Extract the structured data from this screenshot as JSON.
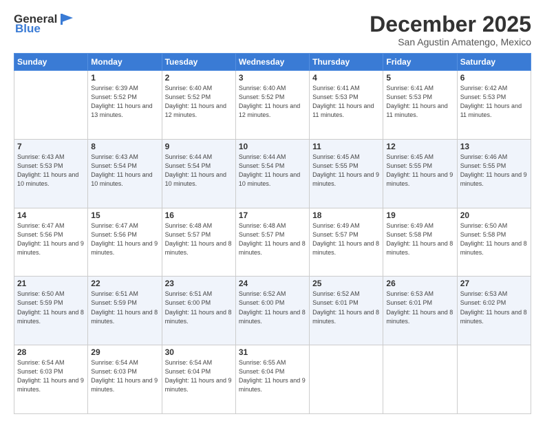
{
  "header": {
    "logo": {
      "general": "General",
      "blue": "Blue"
    },
    "title": "December 2025",
    "location": "San Agustin Amatengo, Mexico"
  },
  "calendar": {
    "weekdays": [
      "Sunday",
      "Monday",
      "Tuesday",
      "Wednesday",
      "Thursday",
      "Friday",
      "Saturday"
    ],
    "rows": [
      [
        {
          "day": "",
          "sunrise": "",
          "sunset": "",
          "daylight": ""
        },
        {
          "day": "1",
          "sunrise": "Sunrise: 6:39 AM",
          "sunset": "Sunset: 5:52 PM",
          "daylight": "Daylight: 11 hours and 13 minutes."
        },
        {
          "day": "2",
          "sunrise": "Sunrise: 6:40 AM",
          "sunset": "Sunset: 5:52 PM",
          "daylight": "Daylight: 11 hours and 12 minutes."
        },
        {
          "day": "3",
          "sunrise": "Sunrise: 6:40 AM",
          "sunset": "Sunset: 5:52 PM",
          "daylight": "Daylight: 11 hours and 12 minutes."
        },
        {
          "day": "4",
          "sunrise": "Sunrise: 6:41 AM",
          "sunset": "Sunset: 5:53 PM",
          "daylight": "Daylight: 11 hours and 11 minutes."
        },
        {
          "day": "5",
          "sunrise": "Sunrise: 6:41 AM",
          "sunset": "Sunset: 5:53 PM",
          "daylight": "Daylight: 11 hours and 11 minutes."
        },
        {
          "day": "6",
          "sunrise": "Sunrise: 6:42 AM",
          "sunset": "Sunset: 5:53 PM",
          "daylight": "Daylight: 11 hours and 11 minutes."
        }
      ],
      [
        {
          "day": "7",
          "sunrise": "Sunrise: 6:43 AM",
          "sunset": "Sunset: 5:53 PM",
          "daylight": "Daylight: 11 hours and 10 minutes."
        },
        {
          "day": "8",
          "sunrise": "Sunrise: 6:43 AM",
          "sunset": "Sunset: 5:54 PM",
          "daylight": "Daylight: 11 hours and 10 minutes."
        },
        {
          "day": "9",
          "sunrise": "Sunrise: 6:44 AM",
          "sunset": "Sunset: 5:54 PM",
          "daylight": "Daylight: 11 hours and 10 minutes."
        },
        {
          "day": "10",
          "sunrise": "Sunrise: 6:44 AM",
          "sunset": "Sunset: 5:54 PM",
          "daylight": "Daylight: 11 hours and 10 minutes."
        },
        {
          "day": "11",
          "sunrise": "Sunrise: 6:45 AM",
          "sunset": "Sunset: 5:55 PM",
          "daylight": "Daylight: 11 hours and 9 minutes."
        },
        {
          "day": "12",
          "sunrise": "Sunrise: 6:45 AM",
          "sunset": "Sunset: 5:55 PM",
          "daylight": "Daylight: 11 hours and 9 minutes."
        },
        {
          "day": "13",
          "sunrise": "Sunrise: 6:46 AM",
          "sunset": "Sunset: 5:55 PM",
          "daylight": "Daylight: 11 hours and 9 minutes."
        }
      ],
      [
        {
          "day": "14",
          "sunrise": "Sunrise: 6:47 AM",
          "sunset": "Sunset: 5:56 PM",
          "daylight": "Daylight: 11 hours and 9 minutes."
        },
        {
          "day": "15",
          "sunrise": "Sunrise: 6:47 AM",
          "sunset": "Sunset: 5:56 PM",
          "daylight": "Daylight: 11 hours and 9 minutes."
        },
        {
          "day": "16",
          "sunrise": "Sunrise: 6:48 AM",
          "sunset": "Sunset: 5:57 PM",
          "daylight": "Daylight: 11 hours and 8 minutes."
        },
        {
          "day": "17",
          "sunrise": "Sunrise: 6:48 AM",
          "sunset": "Sunset: 5:57 PM",
          "daylight": "Daylight: 11 hours and 8 minutes."
        },
        {
          "day": "18",
          "sunrise": "Sunrise: 6:49 AM",
          "sunset": "Sunset: 5:57 PM",
          "daylight": "Daylight: 11 hours and 8 minutes."
        },
        {
          "day": "19",
          "sunrise": "Sunrise: 6:49 AM",
          "sunset": "Sunset: 5:58 PM",
          "daylight": "Daylight: 11 hours and 8 minutes."
        },
        {
          "day": "20",
          "sunrise": "Sunrise: 6:50 AM",
          "sunset": "Sunset: 5:58 PM",
          "daylight": "Daylight: 11 hours and 8 minutes."
        }
      ],
      [
        {
          "day": "21",
          "sunrise": "Sunrise: 6:50 AM",
          "sunset": "Sunset: 5:59 PM",
          "daylight": "Daylight: 11 hours and 8 minutes."
        },
        {
          "day": "22",
          "sunrise": "Sunrise: 6:51 AM",
          "sunset": "Sunset: 5:59 PM",
          "daylight": "Daylight: 11 hours and 8 minutes."
        },
        {
          "day": "23",
          "sunrise": "Sunrise: 6:51 AM",
          "sunset": "Sunset: 6:00 PM",
          "daylight": "Daylight: 11 hours and 8 minutes."
        },
        {
          "day": "24",
          "sunrise": "Sunrise: 6:52 AM",
          "sunset": "Sunset: 6:00 PM",
          "daylight": "Daylight: 11 hours and 8 minutes."
        },
        {
          "day": "25",
          "sunrise": "Sunrise: 6:52 AM",
          "sunset": "Sunset: 6:01 PM",
          "daylight": "Daylight: 11 hours and 8 minutes."
        },
        {
          "day": "26",
          "sunrise": "Sunrise: 6:53 AM",
          "sunset": "Sunset: 6:01 PM",
          "daylight": "Daylight: 11 hours and 8 minutes."
        },
        {
          "day": "27",
          "sunrise": "Sunrise: 6:53 AM",
          "sunset": "Sunset: 6:02 PM",
          "daylight": "Daylight: 11 hours and 8 minutes."
        }
      ],
      [
        {
          "day": "28",
          "sunrise": "Sunrise: 6:54 AM",
          "sunset": "Sunset: 6:03 PM",
          "daylight": "Daylight: 11 hours and 9 minutes."
        },
        {
          "day": "29",
          "sunrise": "Sunrise: 6:54 AM",
          "sunset": "Sunset: 6:03 PM",
          "daylight": "Daylight: 11 hours and 9 minutes."
        },
        {
          "day": "30",
          "sunrise": "Sunrise: 6:54 AM",
          "sunset": "Sunset: 6:04 PM",
          "daylight": "Daylight: 11 hours and 9 minutes."
        },
        {
          "day": "31",
          "sunrise": "Sunrise: 6:55 AM",
          "sunset": "Sunset: 6:04 PM",
          "daylight": "Daylight: 11 hours and 9 minutes."
        },
        {
          "day": "",
          "sunrise": "",
          "sunset": "",
          "daylight": ""
        },
        {
          "day": "",
          "sunrise": "",
          "sunset": "",
          "daylight": ""
        },
        {
          "day": "",
          "sunrise": "",
          "sunset": "",
          "daylight": ""
        }
      ]
    ]
  }
}
